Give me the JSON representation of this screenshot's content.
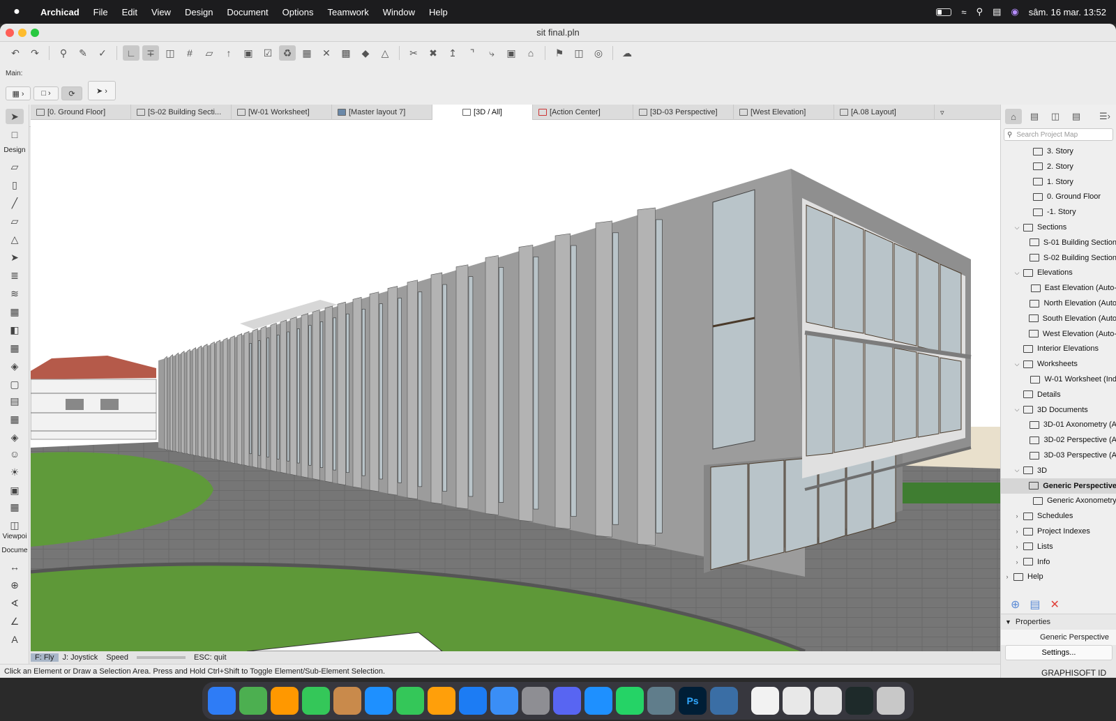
{
  "menubar": {
    "app": "Archicad",
    "items": [
      "File",
      "Edit",
      "View",
      "Design",
      "Document",
      "Options",
      "Teamwork",
      "Window",
      "Help"
    ],
    "datetime": "sâm. 16 mar.  13:52"
  },
  "window": {
    "title": "sit final.pln"
  },
  "infobox": {
    "label": "Main:"
  },
  "tabs": [
    "[0. Ground Floor]",
    "[S-02 Building Secti...",
    "[W-01 Worksheet]",
    "[Master layout 7]",
    "[3D / All]",
    "[Action Center]",
    "[3D-03 Perspective]",
    "[West Elevation]",
    "[A.08 Layout]"
  ],
  "active_tab": 4,
  "lefttools": {
    "design_label": "Design",
    "viewpoint_label": "Viewpoi",
    "document_label": "Docume"
  },
  "navigator": {
    "search_placeholder": "Search Project Map",
    "tree": [
      {
        "label": "3. Story",
        "level": 2,
        "caret": ""
      },
      {
        "label": "2. Story",
        "level": 2,
        "caret": ""
      },
      {
        "label": "1. Story",
        "level": 2,
        "caret": ""
      },
      {
        "label": "0. Ground Floor",
        "level": 2,
        "caret": ""
      },
      {
        "label": "-1. Story",
        "level": 2,
        "caret": ""
      },
      {
        "label": "Sections",
        "level": 1,
        "caret": "v"
      },
      {
        "label": "S-01 Building Section",
        "level": 2,
        "caret": ""
      },
      {
        "label": "S-02 Building Section",
        "level": 2,
        "caret": ""
      },
      {
        "label": "Elevations",
        "level": 1,
        "caret": "v"
      },
      {
        "label": "East Elevation (Auto-",
        "level": 2,
        "caret": ""
      },
      {
        "label": "North Elevation (Auto",
        "level": 2,
        "caret": ""
      },
      {
        "label": "South Elevation (Auto",
        "level": 2,
        "caret": ""
      },
      {
        "label": "West Elevation (Auto-",
        "level": 2,
        "caret": ""
      },
      {
        "label": "Interior Elevations",
        "level": 1,
        "caret": ""
      },
      {
        "label": "Worksheets",
        "level": 1,
        "caret": "v"
      },
      {
        "label": "W-01 Worksheet (Ind",
        "level": 2,
        "caret": ""
      },
      {
        "label": "Details",
        "level": 1,
        "caret": ""
      },
      {
        "label": "3D Documents",
        "level": 1,
        "caret": "v"
      },
      {
        "label": "3D-01 Axonometry (A",
        "level": 2,
        "caret": ""
      },
      {
        "label": "3D-02 Perspective (A",
        "level": 2,
        "caret": ""
      },
      {
        "label": "3D-03 Perspective (A",
        "level": 2,
        "caret": ""
      },
      {
        "label": "3D",
        "level": 1,
        "caret": "v"
      },
      {
        "label": "Generic Perspective",
        "level": 2,
        "caret": "",
        "selected": true
      },
      {
        "label": "Generic Axonometry",
        "level": 2,
        "caret": ""
      },
      {
        "label": "Schedules",
        "level": 1,
        "caret": ">"
      },
      {
        "label": "Project Indexes",
        "level": 1,
        "caret": ">"
      },
      {
        "label": "Lists",
        "level": 1,
        "caret": ">"
      },
      {
        "label": "Info",
        "level": 1,
        "caret": ">"
      },
      {
        "label": "Help",
        "level": 0,
        "caret": ">"
      }
    ],
    "properties_label": "Properties",
    "properties_value": "Generic Perspective",
    "settings_label": "Settings...",
    "graphisoft_label": "GRAPHISOFT ID"
  },
  "flybar": {
    "fly": "F: Fly",
    "joystick": "J: Joystick",
    "speed": "Speed",
    "esc": "ESC: quit"
  },
  "status": "Click an Element or Draw a Selection Area. Press and Hold Ctrl+Shift to Toggle Element/Sub-Element Selection.",
  "dock": [
    "Finder",
    "Maps",
    "Photos",
    "FaceTime",
    "Contacts",
    "Keynote",
    "Numbers",
    "Pages",
    "App Store",
    "Mail",
    "Settings",
    "Discord",
    "Safari",
    "WhatsApp",
    "Preview",
    "Ps",
    "Archicad",
    "Doc1",
    "Doc2",
    "Doc3",
    "Doc4",
    "Trash"
  ],
  "dock_ps": "Ps",
  "colors": {
    "accent": "#a8b6c8",
    "building": "#a7a7a7",
    "glass": "#b9c4c9",
    "grass": "#5f9a3a",
    "pavement": "#7a7a7a"
  }
}
